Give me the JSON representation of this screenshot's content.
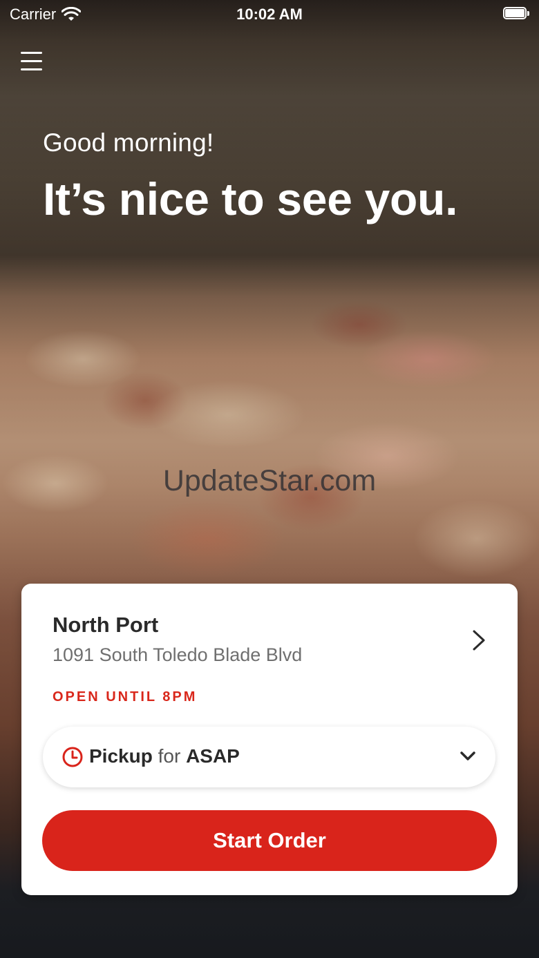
{
  "status_bar": {
    "carrier": "Carrier",
    "time": "10:02 AM",
    "icons": [
      "wifi-icon",
      "battery-icon"
    ]
  },
  "header": {
    "menu_icon": "hamburger-menu-icon",
    "greeting": "Good morning!",
    "headline": "It’s nice to see you."
  },
  "watermark": "UpdateStar.com",
  "store_card": {
    "name": "North Port",
    "address": "1091 South Toledo Blade Blvd",
    "open_status": "OPEN UNTIL 8PM",
    "order_mode": {
      "icon": "clock-icon",
      "mode": "Pickup",
      "connector": "for",
      "time": "ASAP"
    },
    "start_order_label": "Start Order"
  },
  "colors": {
    "accent_red": "#d9241b",
    "text_dark": "#2a2a2a",
    "text_muted": "#6f6f6f",
    "card_background": "#ffffff"
  }
}
